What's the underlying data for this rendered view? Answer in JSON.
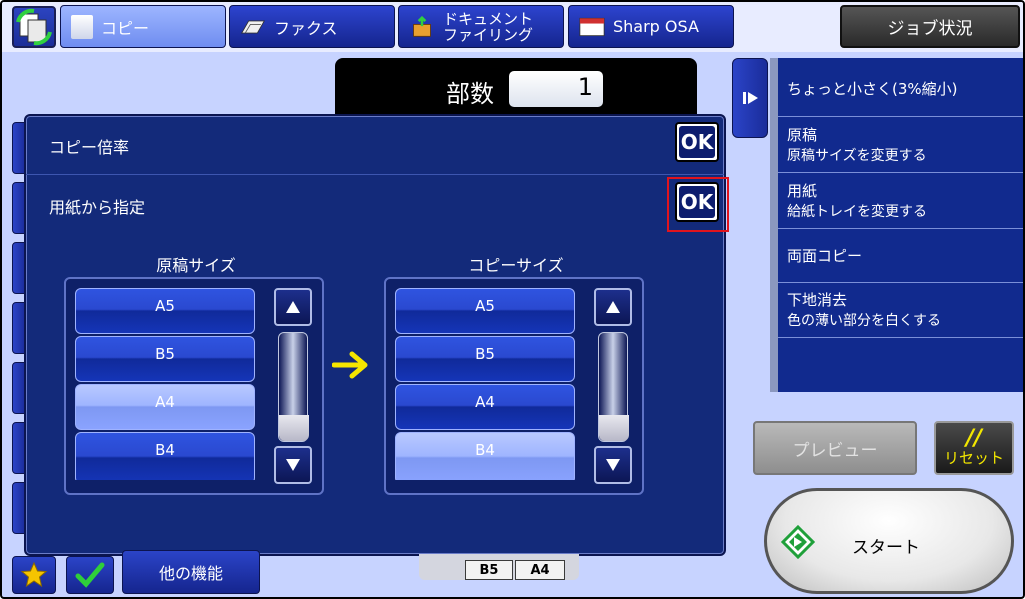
{
  "tabs": [
    {
      "label": "コピー",
      "state": "active"
    },
    {
      "label": "ファクス",
      "state": "inactive"
    },
    {
      "label_line1": "ドキュメント",
      "label_line2": "ファイリング",
      "state": "inactive"
    },
    {
      "label": "Sharp OSA",
      "state": "inactive"
    }
  ],
  "job_status": "ジョブ状況",
  "copies": {
    "label": "部数",
    "value": "1"
  },
  "dialog": {
    "rows": [
      {
        "label": "コピー倍率",
        "ok": "OK"
      },
      {
        "label": "用紙から指定",
        "ok": "OK"
      }
    ],
    "original_size": {
      "title": "原稿サイズ",
      "options": [
        "A5",
        "B5",
        "A4",
        "B4"
      ],
      "selected": "A4"
    },
    "copy_size": {
      "title": "コピーサイズ",
      "options": [
        "A5",
        "B5",
        "A4",
        "B4"
      ],
      "selected": "B4"
    }
  },
  "sidebar": {
    "items": [
      {
        "title": "ちょっと小さく(3%縮小)",
        "sub": ""
      },
      {
        "title": "原稿",
        "sub": "原稿サイズを変更する"
      },
      {
        "title": "用紙",
        "sub": "給紙トレイを変更する"
      },
      {
        "title": "両面コピー",
        "sub": ""
      },
      {
        "title": "下地消去",
        "sub": "色の薄い部分を白くする"
      }
    ]
  },
  "buttons": {
    "preview": "プレビュー",
    "reset_icon": "//",
    "reset": "リセット",
    "start": "スタート",
    "other_functions": "他の機能"
  },
  "tray": [
    "B5",
    "A4"
  ],
  "colors": {
    "highlight": "#e0141d",
    "start_icon": "#1fa03a",
    "arrow": "#f5e600"
  }
}
